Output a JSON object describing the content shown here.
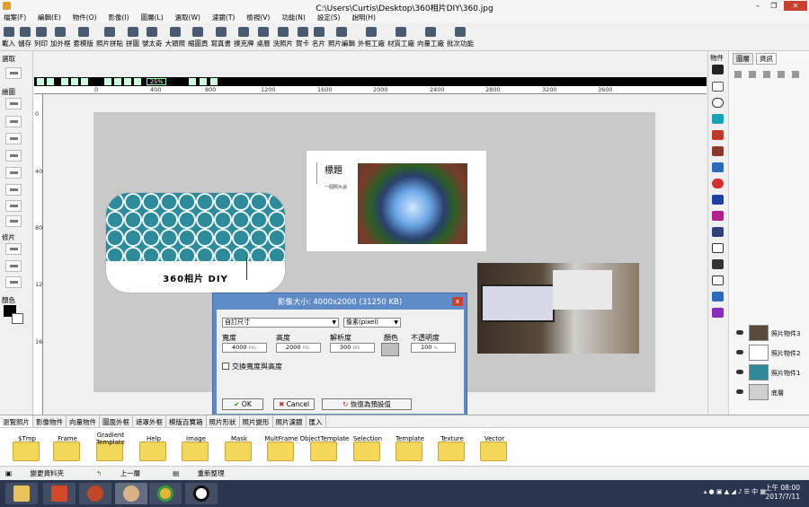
{
  "window": {
    "title": "C:\\Users\\Curtis\\Desktop\\360相片DIY\\360.jpg",
    "minimize": "–",
    "restore": "❐",
    "close": "✕"
  },
  "menu": [
    "檔案(F)",
    "編輯(E)",
    "物件(O)",
    "影像(I)",
    "圖層(L)",
    "選取(W)",
    "濾鏡(T)",
    "檢視(V)",
    "功能(N)",
    "設定(S)",
    "說明(H)"
  ],
  "toolbar": [
    "載入",
    "儲存",
    "列印",
    "加外框",
    "套模版",
    "照片拼貼",
    "拼圖",
    "號太奇",
    "大頭照",
    "縮圖頁",
    "寫真書",
    "撲克牌",
    "桌曆",
    "洗照片",
    "賀卡",
    "名片",
    "照片編輯",
    "外框工廠",
    "材質工廠",
    "向量工廠",
    "批次功能"
  ],
  "left_panel": {
    "select_label": "選取",
    "draw_label": "繪圖",
    "retouch_label": "修片",
    "color_label": "顏色"
  },
  "canvas": {
    "zoom": "25%",
    "ruler_top": [
      "0",
      "400",
      "800",
      "1200",
      "1600",
      "2000",
      "2400",
      "2800",
      "3200",
      "3600"
    ],
    "ruler_left": [
      "0",
      "400",
      "800",
      "1200",
      "1600"
    ]
  },
  "card": {
    "text": "360相片 DIY"
  },
  "panel": {
    "title": "標題",
    "subtitle": "一個照片說"
  },
  "right_vbar": {
    "label": "物件"
  },
  "right_panel": {
    "tabs": [
      "圖層",
      "資訊"
    ],
    "layers": [
      "照片物件3",
      "照片物件2",
      "照片物件1",
      "底層"
    ]
  },
  "dialog": {
    "title": "影像大小: 4000x2000 (31250 KB)",
    "close": "x",
    "preset": "自訂尺寸",
    "unit": "像素(pixel)",
    "labels": {
      "width": "寬度",
      "height": "高度",
      "resolution": "解析度",
      "color": "顏色",
      "opacity": "不透明度"
    },
    "values": {
      "width": "4000",
      "height": "2000",
      "resolution": "300",
      "opacity": "100"
    },
    "units": {
      "width": "PXL",
      "height": "PXL",
      "resolution": "DPI",
      "opacity": "%"
    },
    "swap_label": "交換寬度與高度",
    "ok": "OK",
    "cancel": "Cancel",
    "reset": "恢復為預設值"
  },
  "bottom_tabs": [
    "瀏覽照片",
    "影像物件",
    "向量物件",
    "圖面外框",
    "遮罩外框",
    "模版百寶箱",
    "照片形狀",
    "照片變形",
    "照片濾鏡",
    "匯入"
  ],
  "folders": [
    "$Tmp",
    "Frame",
    "Gradient Template",
    "Help",
    "Image",
    "Mask",
    "MultFrame",
    "ObjectTemplate",
    "Selection",
    "Template",
    "Texture",
    "Vector"
  ],
  "statusbar": [
    "變更資料夾",
    "上一層",
    "重新整理"
  ],
  "taskbar": {
    "clock_time": "上午 08:00",
    "clock_date": "2017/7/11",
    "ime": "中"
  }
}
